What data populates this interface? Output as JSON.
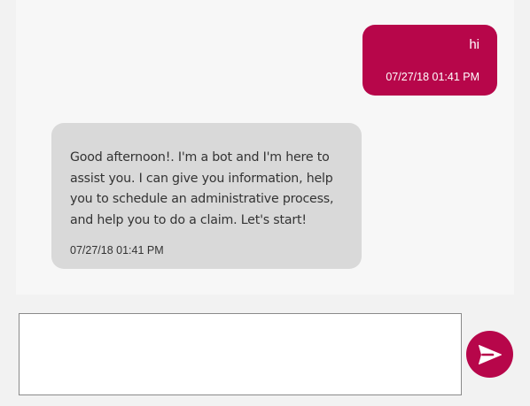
{
  "colors": {
    "accent": "#b7064a",
    "bot_bubble": "#d9d9d9",
    "chat_background": "#f7f7f7"
  },
  "conversation": {
    "messages": [
      {
        "sender": "user",
        "text": "hi",
        "time": "07/27/18 01:41 PM"
      },
      {
        "sender": "bot",
        "text": "Good afternoon!. I'm a bot and I'm here to assist you. I can give you information, help you to schedule an administrative process, and help you to do a claim. Let's start!",
        "time": "07/27/18 01:41 PM"
      }
    ]
  },
  "composer": {
    "value": "",
    "send_icon": "send-icon"
  }
}
